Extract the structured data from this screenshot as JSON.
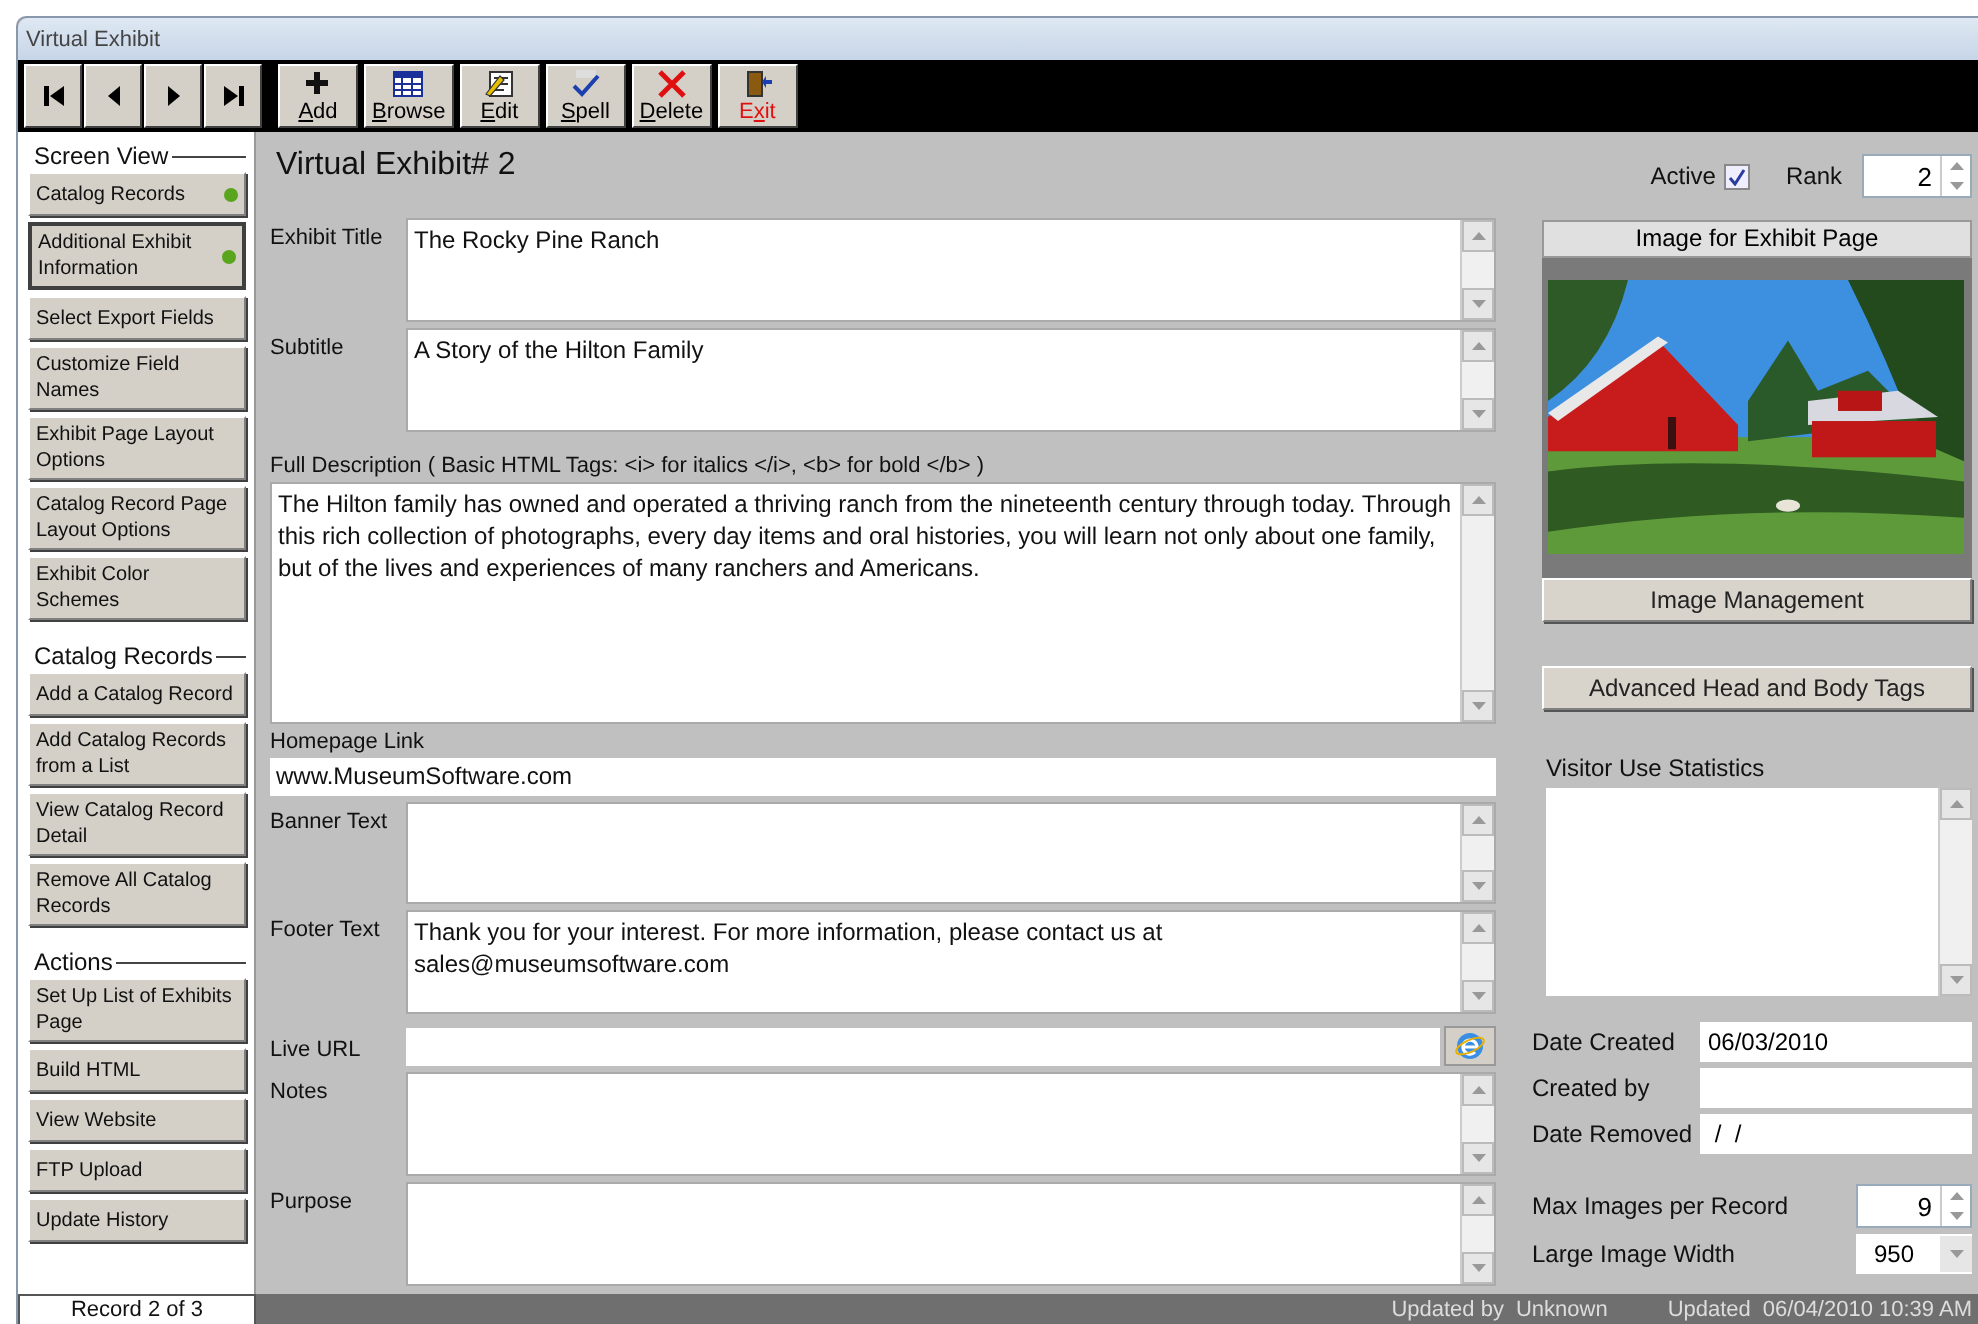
{
  "window": {
    "title": "Virtual Exhibit"
  },
  "toolbar": {
    "nav": [
      {
        "kind": "first"
      },
      {
        "kind": "prev"
      },
      {
        "kind": "next"
      },
      {
        "kind": "last"
      }
    ],
    "buttons": [
      {
        "kind": "add",
        "key": "A",
        "after": "dd",
        "danger": false
      },
      {
        "kind": "browse",
        "key": "B",
        "after": "rowse",
        "danger": false
      },
      {
        "kind": "edit",
        "key": "E",
        "after": "dit",
        "danger": false
      },
      {
        "kind": "spell",
        "key": "S",
        "after": "pell",
        "danger": false
      },
      {
        "kind": "delete",
        "key": "D",
        "after": "elete",
        "danger": false
      },
      {
        "kind": "exit",
        "before": "E",
        "key": "x",
        "after": "it",
        "danger": true
      }
    ]
  },
  "sidebar": {
    "sections": [
      {
        "title": "Screen View",
        "items": [
          {
            "label": "Catalog Records",
            "selected": false,
            "dot": true
          },
          {
            "label": "Additional Exhibit Information",
            "selected": true,
            "dot": true
          },
          {
            "label": "Select Export Fields",
            "selected": false,
            "dot": false
          },
          {
            "label": "Customize Field Names",
            "selected": false,
            "dot": false
          },
          {
            "label": "Exhibit Page Layout Options",
            "selected": false,
            "dot": false
          },
          {
            "label": "Catalog Record Page Layout Options",
            "selected": false,
            "dot": false
          },
          {
            "label": "Exhibit Color Schemes",
            "selected": false,
            "dot": false
          }
        ]
      },
      {
        "title": "Catalog Records",
        "items": [
          {
            "label": "Add a Catalog Record",
            "selected": false,
            "dot": false
          },
          {
            "label": "Add Catalog Records from a List",
            "selected": false,
            "dot": false
          },
          {
            "label": "View Catalog Record Detail",
            "selected": false,
            "dot": false
          },
          {
            "label": "Remove All Catalog Records",
            "selected": false,
            "dot": false
          }
        ]
      },
      {
        "title": "Actions",
        "items": [
          {
            "label": "Set Up List of Exhibits Page",
            "selected": false,
            "dot": false
          },
          {
            "label": "Build HTML",
            "selected": false,
            "dot": false
          },
          {
            "label": "View Website",
            "selected": false,
            "dot": false
          },
          {
            "label": "FTP Upload",
            "selected": false,
            "dot": false
          },
          {
            "label": "Update History",
            "selected": false,
            "dot": false
          }
        ]
      }
    ]
  },
  "form": {
    "heading": "Virtual Exhibit# 2",
    "fields": [
      {
        "kind": "memo",
        "label": "Exhibit Title",
        "value": "The Rocky Pine Ranch"
      },
      {
        "kind": "memo",
        "label": "Subtitle",
        "value": "A Story of the Hilton Family"
      },
      {
        "kind": "memo-wide",
        "label": "Full Description ( Basic HTML Tags: <i> for italics </i>, <b> for bold </b> )",
        "value": "The Hilton family has owned and operated a thriving ranch from the nineteenth century through today. Through this rich collection of photographs, every day items and oral histories, you will learn not only about one family, but of the lives and experiences of many ranchers and Americans."
      },
      {
        "kind": "line-wide",
        "label": "Homepage Link",
        "value": "www.MuseumSoftware.com"
      },
      {
        "kind": "memo",
        "label": "Banner Text"
      },
      {
        "kind": "memo",
        "label": "Footer Text",
        "value": "Thank you for your interest. For more information, please contact us at sales@museumsoftware.com"
      },
      {
        "kind": "url",
        "label": "Live URL"
      },
      {
        "kind": "memo",
        "label": "Notes"
      },
      {
        "kind": "memo",
        "label": "Purpose"
      }
    ]
  },
  "side": {
    "active": {
      "label": "Active",
      "checked": true
    },
    "rank": {
      "label": "Rank",
      "value": "2"
    },
    "image": {
      "title": "Image for Exhibit Page",
      "button": "Image Management"
    },
    "advanced_button": "Advanced Head and Body Tags",
    "stats": {
      "label": "Visitor Use Statistics"
    },
    "info": [
      {
        "kind": "text",
        "label": "Date Created",
        "value": "06/03/2010"
      },
      {
        "kind": "text",
        "label": "Created by"
      },
      {
        "kind": "text",
        "label": "Date Removed",
        "value": " /  /"
      },
      {
        "kind": "spin",
        "label": "Max Images per Record",
        "value": "9"
      },
      {
        "kind": "combo",
        "label": "Large Image Width",
        "value": "950"
      }
    ]
  },
  "status_bar": {
    "record": "Record 2 of 3",
    "updated_by_label": "Updated by",
    "updated_by": "Unknown",
    "updated_label": "Updated",
    "updated": "06/04/2010 10:39 AM"
  }
}
